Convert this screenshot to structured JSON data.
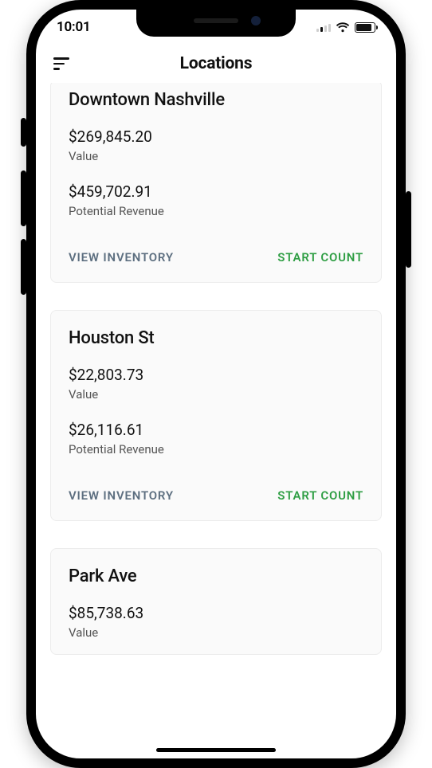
{
  "status": {
    "time": "10:01"
  },
  "header": {
    "title": "Locations"
  },
  "labels": {
    "value": "Value",
    "potential": "Potential Revenue",
    "view": "VIEW INVENTORY",
    "count": "START COUNT"
  },
  "locations": [
    {
      "name": "Downtown Nashville",
      "value": "$269,845.20",
      "potential": "$459,702.91"
    },
    {
      "name": "Houston St",
      "value": "$22,803.73",
      "potential": "$26,116.61"
    },
    {
      "name": "Park Ave",
      "value": "$85,738.63",
      "potential": ""
    }
  ]
}
